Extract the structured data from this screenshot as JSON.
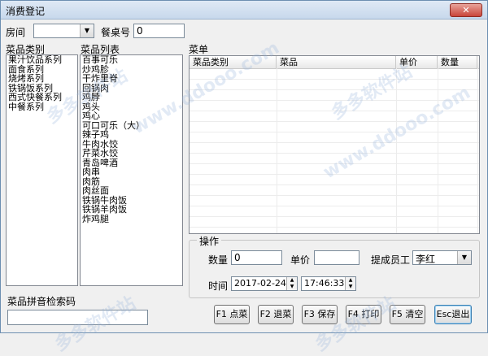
{
  "window": {
    "title": "消费登记",
    "close_glyph": "✕"
  },
  "top_bar": {
    "room_label": "房间",
    "room_value": "",
    "table_label": "餐桌号",
    "table_value": "0"
  },
  "categories": {
    "label": "菜品类别",
    "items": [
      "果汁饮品系列",
      "面食系列",
      "烧烤系列",
      "铁锅饭系列",
      "西式快餐系列",
      "中餐系列"
    ]
  },
  "dishes": {
    "label": "菜品列表",
    "items": [
      "百事可乐",
      "炒鸡胗",
      "干炸里脊",
      "回锅肉",
      "鸡脖",
      "鸡头",
      "鸡心",
      "可口可乐（大）",
      "辣子鸡",
      "牛肉水饺",
      "芹菜水饺",
      "青岛啤酒",
      "肉串",
      "肉筋",
      "肉丝面",
      "铁锅牛肉饭",
      "铁锅羊肉饭",
      "炸鸡腿"
    ]
  },
  "menu": {
    "label": "菜单",
    "columns": [
      "菜品类别",
      "菜品",
      "单价",
      "数量"
    ]
  },
  "operation": {
    "group_label": "操作",
    "qty_label": "数量",
    "qty_value": "0",
    "price_label": "单价",
    "price_value": "",
    "staff_label": "提成员工",
    "staff_value": "李红",
    "time_label": "时间",
    "date_value": "2017-02-24",
    "time_value": "17:46:33"
  },
  "search": {
    "label": "菜品拼音检索码",
    "value": ""
  },
  "buttons": {
    "order": "F1 点菜",
    "return": "F2 退菜",
    "save": "F3 保存",
    "print": "F4 打印",
    "clear": "F5 清空",
    "exit": "Esc退出"
  },
  "watermarks": {
    "site": "www.ddooo.com",
    "brand": "多多软件站"
  }
}
